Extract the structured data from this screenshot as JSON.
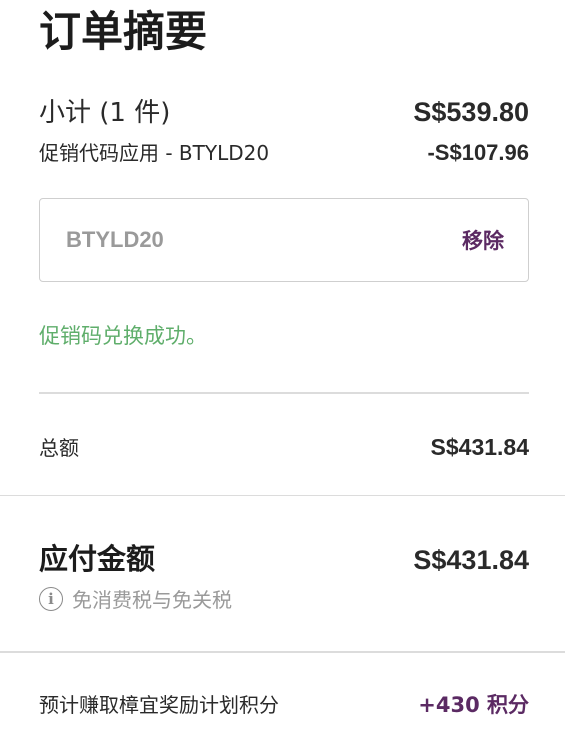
{
  "summary": {
    "title": "订单摘要",
    "subtotal_label": "小计 (1 件)",
    "subtotal_value": "S$539.80",
    "promo_label": "促销代码应用 - BTYLD20",
    "promo_value": "-S$107.96"
  },
  "promo_box": {
    "code": "BTYLD20",
    "remove_label": "移除"
  },
  "success_message": "促销码兑换成功。",
  "total": {
    "label": "总额",
    "value": "S$431.84"
  },
  "amount_due": {
    "label": "应付金额",
    "value": "S$431.84",
    "tax_note": "免消费税与免关税",
    "info_icon": "info-icon"
  },
  "rewards": {
    "label": "预计赚取樟宜奖励计划积分",
    "value": "+430 积分"
  },
  "colors": {
    "accent": "#5b2a63",
    "success": "#5fae6b",
    "muted": "#9a9a9a",
    "divider": "#dcdcdc"
  }
}
